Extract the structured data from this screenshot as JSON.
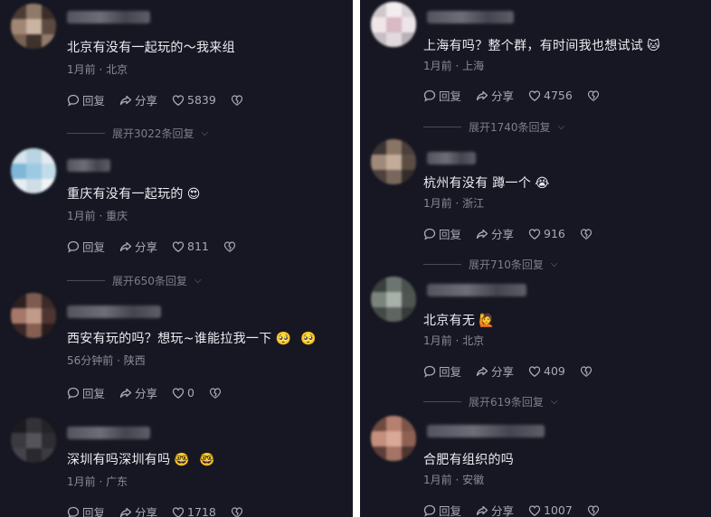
{
  "left": {
    "comments": [
      {
        "text": "北京有没有一起玩的～我来组",
        "meta": "1月前 · 北京",
        "reply": "回复",
        "share": "分享",
        "likes": "5839",
        "expand": "展开3022条回复"
      },
      {
        "text": "重庆有没有一起玩的",
        "meta": "1月前 · 重庆",
        "reply": "回复",
        "share": "分享",
        "likes": "811",
        "expand": "展开650条回复"
      },
      {
        "text": "西安有玩的吗？想玩~谁能拉我一下",
        "meta": "56分钟前 · 陕西",
        "reply": "回复",
        "share": "分享",
        "likes": "0"
      },
      {
        "text": "深圳有吗深圳有吗",
        "meta": "1月前 · 广东",
        "reply": "回复",
        "share": "分享",
        "likes": "1718"
      }
    ]
  },
  "right": {
    "comments": [
      {
        "text": "上海有吗？整个群，有时间我也想试试",
        "meta": "1月前 · 上海",
        "reply": "回复",
        "share": "分享",
        "likes": "4756",
        "expand": "展开1740条回复"
      },
      {
        "text": "杭州有没有 蹲一个",
        "meta": "1月前 · 浙江",
        "reply": "回复",
        "share": "分享",
        "likes": "916",
        "expand": "展开710条回复"
      },
      {
        "text": "北京有无",
        "meta": "1月前 · 北京",
        "reply": "回复",
        "share": "分享",
        "likes": "409",
        "expand": "展开619条回复"
      },
      {
        "text": "合肥有组织的吗",
        "meta": "1月前 · 安徽",
        "reply": "回复",
        "share": "分享",
        "likes": "1007"
      }
    ]
  },
  "colors": {
    "background": "#161722",
    "text": "#ececf2",
    "meta": "#8a8b96",
    "divider": "#ffffff"
  },
  "icons": {
    "reply": "comment-bubble-icon",
    "share": "share-arrow-icon",
    "like": "heart-icon",
    "dislike": "broken-heart-icon"
  }
}
